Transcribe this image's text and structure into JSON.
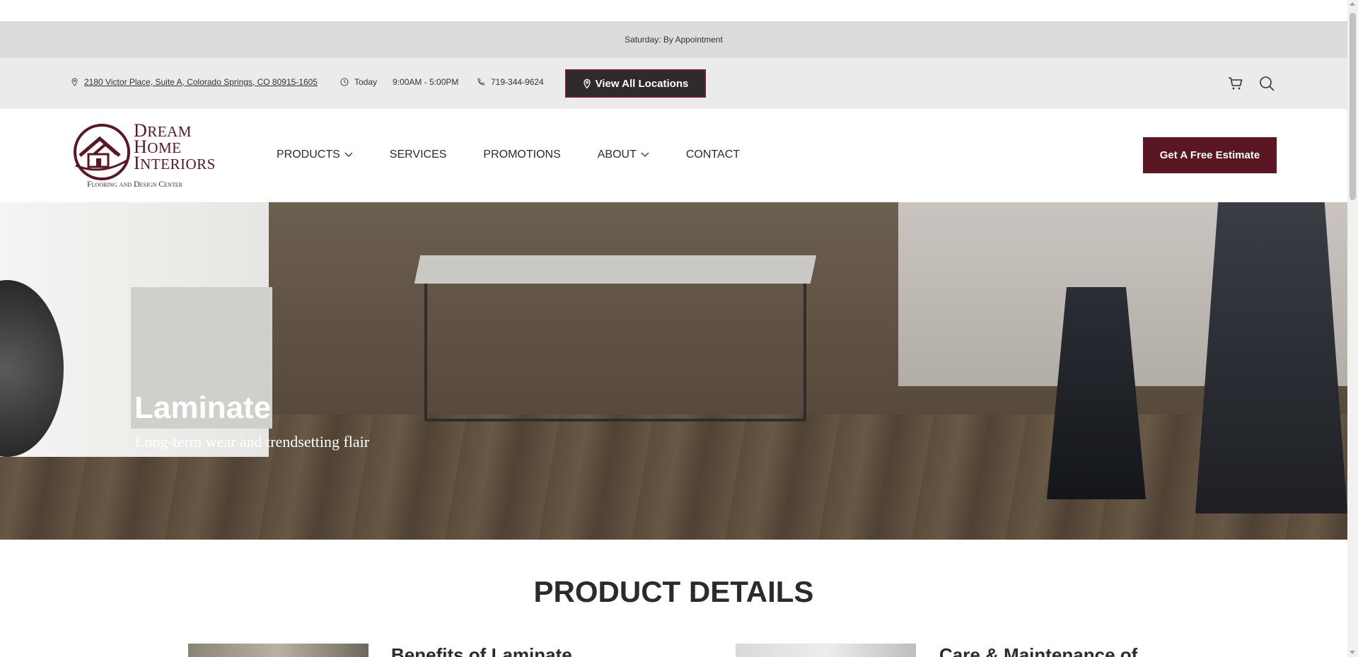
{
  "announcement": {
    "text": "Saturday: By Appointment"
  },
  "infobar": {
    "address": "2180 Victor Place, Suite A, Colorado Springs, CO 80915-1605",
    "hours_day": "Today",
    "hours_time": "9:00AM - 5:00PM",
    "phone": "719-344-9624",
    "locations_button": "View All Locations"
  },
  "logo": {
    "line1_cap": "D",
    "line1_rest": "REAM",
    "line2_cap": "H",
    "line2_rest": "OME",
    "line3_cap": "I",
    "line3_rest": "NTERIORS",
    "subtitle": "Flooring and Design Center"
  },
  "nav": {
    "products": "PRODUCTS",
    "services": "SERVICES",
    "promotions": "PROMOTIONS",
    "about": "ABOUT",
    "contact": "CONTACT"
  },
  "header": {
    "estimate_button": "Get A Free Estimate"
  },
  "hero": {
    "title": "Laminate",
    "subtitle": "Long-term wear and trendsetting flair"
  },
  "details": {
    "title": "PRODUCT DETAILS",
    "card1_title": "Benefits of Laminate",
    "card2_title": "Care & Maintenance of"
  },
  "colors": {
    "brand": "#5a1622",
    "button_dark": "#2f2a2b",
    "announcement_bg": "#dcdcdc",
    "infobar_bg": "#ebebeb"
  },
  "icons": [
    "pin-icon",
    "clock-icon",
    "phone-icon",
    "cart-icon",
    "search-icon",
    "chevron-down-icon"
  ]
}
